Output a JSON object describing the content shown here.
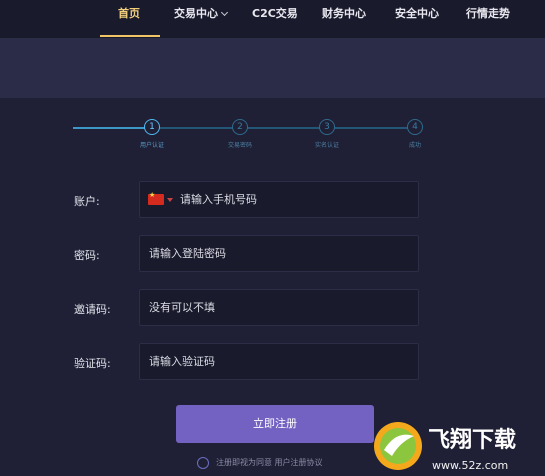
{
  "nav": {
    "items": [
      {
        "label": "首页",
        "active": true
      },
      {
        "label": "交易中心",
        "dropdown": true
      },
      {
        "label": "C2C交易"
      },
      {
        "label": "财务中心"
      },
      {
        "label": "安全中心"
      },
      {
        "label": "行情走势"
      }
    ]
  },
  "steps": [
    {
      "number": "1",
      "label": "用户认证",
      "state": "current"
    },
    {
      "number": "2",
      "label": "交易密码",
      "state": "pending"
    },
    {
      "number": "3",
      "label": "实名认证",
      "state": "pending"
    },
    {
      "number": "4",
      "label": "成功",
      "state": "pending"
    }
  ],
  "form": {
    "account": {
      "label": "账户:",
      "placeholder": "请输入手机号码",
      "country_flag": "china-flag-icon"
    },
    "password": {
      "label": "密码:",
      "placeholder": "请输入登陆密码"
    },
    "invite": {
      "label": "邀请码:",
      "placeholder": "没有可以不填"
    },
    "captcha": {
      "label": "验证码:",
      "placeholder": "请输入验证码"
    }
  },
  "submit_label": "立即注册",
  "agreement": {
    "text": "注册即视为同意 用户注册协议"
  },
  "watermark": {
    "title": "飞翔下载",
    "url": "www.52z.com"
  },
  "colors": {
    "accent": "#7462c2",
    "nav_active": "#f3cf7c",
    "step_active": "#4fb8f0",
    "background": "#1f2035"
  }
}
